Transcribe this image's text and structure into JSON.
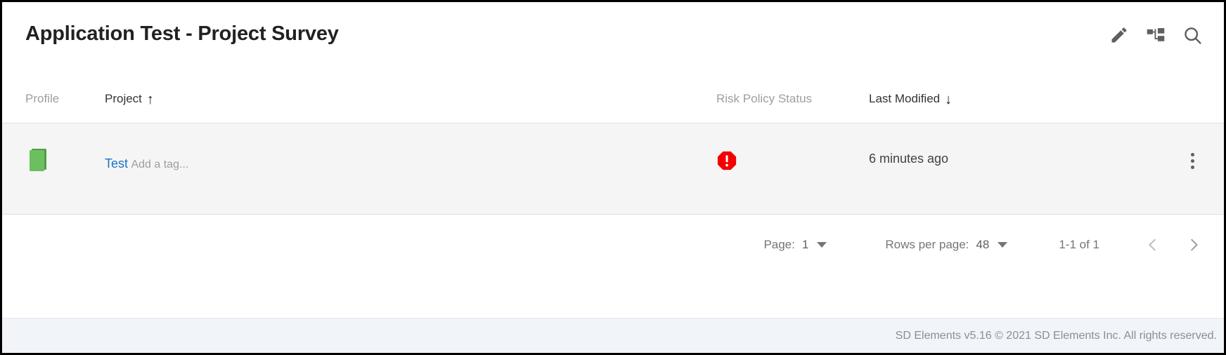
{
  "header": {
    "title": "Application Test - Project Survey",
    "actions": [
      {
        "name": "edit-icon",
        "label": "Edit"
      },
      {
        "name": "hierarchy-icon",
        "label": "Hierarchy"
      },
      {
        "name": "search-icon",
        "label": "Search"
      }
    ]
  },
  "table": {
    "columns": {
      "profile": "Profile",
      "project": "Project",
      "risk": "Risk Policy Status",
      "modified": "Last Modified"
    },
    "sort": {
      "project_arrow": "↑",
      "modified_arrow": "↓"
    },
    "rows": [
      {
        "profile_icon": "stacked-books-icon",
        "profile_color": "#6cbf5e",
        "project": "Test",
        "tag_placeholder": "Add a tag...",
        "risk_status": "critical",
        "risk_color": "#f50000",
        "last_modified": "6 minutes ago",
        "actions_icon": "kebab-menu-icon"
      }
    ]
  },
  "pagination": {
    "page_label": "Page:",
    "page_value": "1",
    "rows_label": "Rows per page:",
    "rows_value": "48",
    "range": "1-1 of 1",
    "prev_icon": "chevron-left-icon",
    "next_icon": "chevron-right-icon"
  },
  "footer": {
    "text": "SD Elements v5.16 © 2021 SD Elements Inc. All rights reserved."
  },
  "colors": {
    "link": "#1a73c8",
    "row_bg": "#f5f5f5",
    "footer_bg": "#f1f4f9",
    "green": "#6cbf5e",
    "red": "#f50000"
  }
}
